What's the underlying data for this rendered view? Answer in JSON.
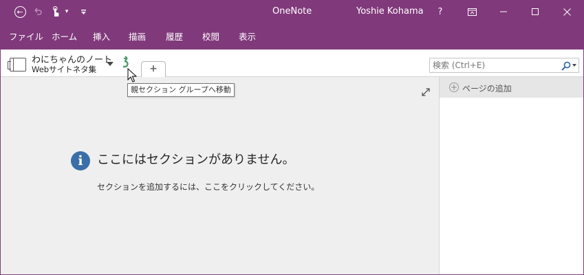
{
  "window": {
    "app_title": "OneNote",
    "user_name": "Yoshie Kohama",
    "help_label": "?",
    "accent_color": "#80397b"
  },
  "quick_access": {
    "icons": [
      "back-icon",
      "undo-icon",
      "touch-mode-icon",
      "customize-icon"
    ]
  },
  "menu": {
    "items": [
      "ファイル",
      "ホーム",
      "挿入",
      "描画",
      "履歴",
      "校閲",
      "表示"
    ]
  },
  "notebook": {
    "name": "わにちゃんのノート",
    "section_group": "Webサイトネタ集"
  },
  "search": {
    "placeholder": "検索 (Ctrl+E)"
  },
  "tooltip": {
    "text": "親セクション グループへ移動"
  },
  "main": {
    "empty_title": "ここにはセクションがありません。",
    "empty_subtitle": "セクションを追加するには、ここをクリックしてください。"
  },
  "pages_pane": {
    "add_page_label": "ページの追加"
  }
}
